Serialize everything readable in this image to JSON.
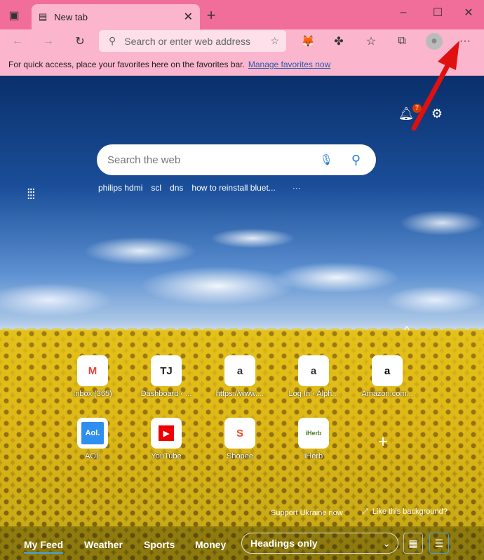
{
  "browser": {
    "tab_title": "New tab",
    "address_placeholder": "Search or enter web address",
    "favorites_message": "For quick access, place your favorites here on the favorites bar.",
    "manage_favorites": "Manage favorites now",
    "theme_color": "#f26e9a"
  },
  "newtab": {
    "search_placeholder": "Search the web",
    "notification_count": "7",
    "suggestions": [
      "philips hdmi",
      "scl",
      "dns",
      "how to reinstall bluet..."
    ],
    "tiles": [
      {
        "label": "Inbox (365)",
        "icon": "M",
        "color": "#ea4335"
      },
      {
        "label": "Dashboard ‹ ...",
        "icon": "TJ",
        "color": "#222"
      },
      {
        "label": "https://www....",
        "icon": "a",
        "color": "#333"
      },
      {
        "label": "Log In ‹ Alph...",
        "icon": "a",
        "color": "#333"
      },
      {
        "label": "Amazon.com...",
        "icon": "a",
        "color": "#000"
      },
      {
        "label": "AOL",
        "icon": "Aol.",
        "color": "#fff"
      },
      {
        "label": "YouTube",
        "icon": "▶",
        "color": "#fff"
      },
      {
        "label": "Shopee",
        "icon": "S",
        "color": "#ee4d2d"
      },
      {
        "label": "iHerb",
        "icon": "iHerb",
        "color": "#4a7a2a"
      }
    ],
    "support_link": "Support Ukraine now",
    "like_background": "Like this background?",
    "feed_tabs": [
      "My Feed",
      "Weather",
      "Sports",
      "Money"
    ],
    "layout_select": "Headings only"
  }
}
